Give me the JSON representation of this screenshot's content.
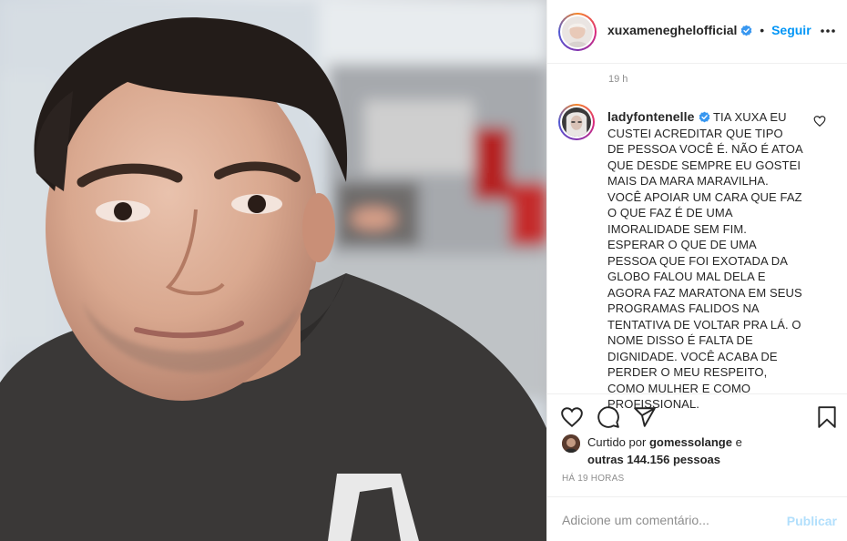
{
  "post": {
    "author": "xuxameneghelofficial",
    "follow_label": "Seguir",
    "separator": "•",
    "time_ago": "19 h"
  },
  "comment": {
    "author": "ladyfontenelle",
    "text": "TIA XUXA EU CUSTEI ACREDITAR QUE TIPO DE PESSOA VOCÊ É. NÃO É ATOA QUE DESDE SEMPRE EU GOSTEI MAIS DA MARA MARAVILHA. VOCÊ APOIAR UM CARA QUE FAZ O QUE FAZ É DE UMA IMORALIDADE SEM FIM. ESPERAR O QUE DE UMA PESSOA QUE FOI EXOTADA DA GLOBO FALOU MAL DELA E AGORA FAZ MARATONA EM SEUS PROGRAMAS FALIDOS NA TENTATIVA DE VOLTAR PRA LÁ. O NOME DISSO É FALTA DE DIGNIDADE. VOCÊ ACABA DE PERDER O MEU RESPEITO, COMO MULHER E COMO PROFISSIONAL."
  },
  "likes": {
    "prefix": "Curtido por",
    "first_user": "gomessolange",
    "conjunction": "e",
    "others": "outras 144.156 pessoas"
  },
  "posted_ago": "HÁ 19 HORAS",
  "comment_box": {
    "placeholder": "Adicione um comentário...",
    "publish_label": "Publicar"
  },
  "icons": {
    "verified": "verified-badge-icon",
    "more": "more-options-icon",
    "like": "heart-icon",
    "comment": "comment-icon",
    "share": "share-icon",
    "save": "bookmark-icon"
  },
  "colors": {
    "accent": "#0095f6",
    "verified": "#3897f0",
    "publish_disabled": "#b2dffc",
    "muted": "#8e8e8e"
  }
}
